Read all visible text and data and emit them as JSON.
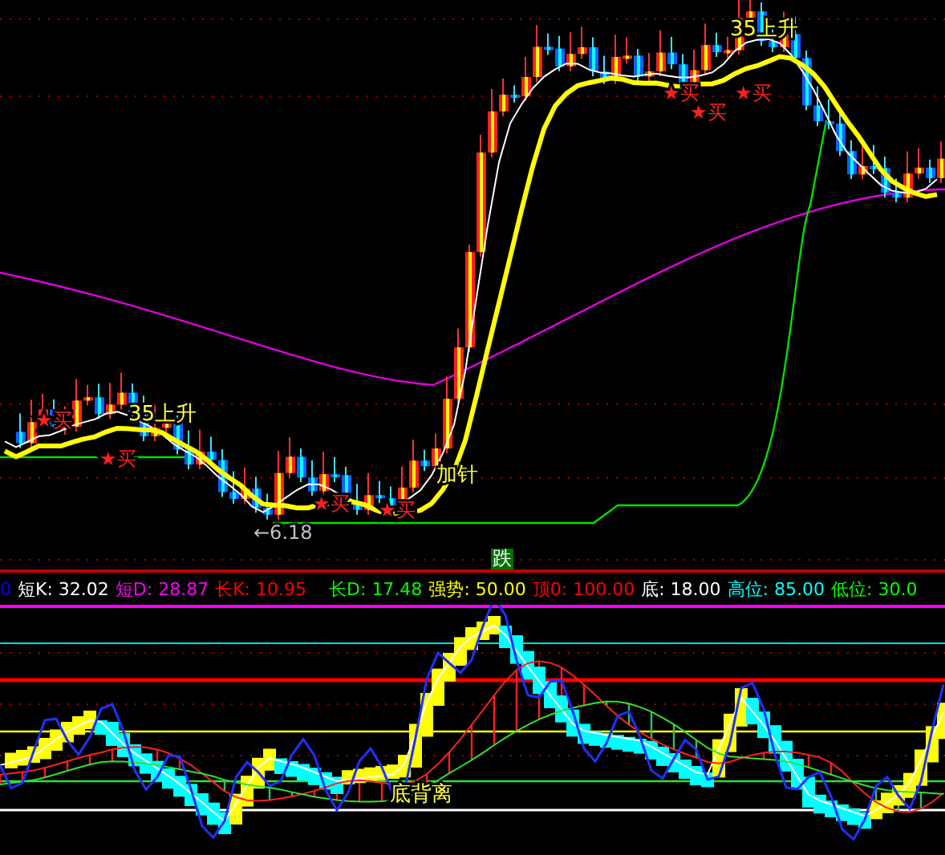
{
  "price_chart": {
    "annotations": [
      {
        "kind": "trend",
        "text": "35上升"
      },
      {
        "kind": "trend",
        "text": "35上升"
      },
      {
        "kind": "trend",
        "text": "加针"
      },
      {
        "kind": "buy",
        "text": "★买"
      },
      {
        "kind": "buy",
        "text": "★买"
      },
      {
        "kind": "buy",
        "text": "★买"
      },
      {
        "kind": "buy",
        "text": "★买"
      },
      {
        "kind": "buy",
        "text": "★买"
      },
      {
        "kind": "buy",
        "text": "★买"
      },
      {
        "kind": "buy",
        "text": "★买"
      },
      {
        "kind": "low",
        "text": "←6.18"
      }
    ]
  },
  "signal_badge": "跌",
  "indicators": [
    {
      "text": "0",
      "color": "#0000ff"
    },
    {
      "text": "短K: 32.02",
      "color": "#ffffff"
    },
    {
      "text": "短D: 28.87",
      "color": "#ff00ff"
    },
    {
      "text": "长K: 10.95",
      "color": "#ff0000"
    },
    {
      "text": "长D: 17.48",
      "color": "#00ff00"
    },
    {
      "text": "强势: 50.00",
      "color": "#ffff00"
    },
    {
      "text": "顶0: 100.00",
      "color": "#ff0000"
    },
    {
      "text": "底: 18.00",
      "color": "#ffffff"
    },
    {
      "text": "高位: 85.00",
      "color": "#00ffff"
    },
    {
      "text": "低位: 30.0",
      "color": "#00ff00"
    }
  ],
  "oscillator": {
    "annotations": [
      {
        "kind": "divergence",
        "text": "底背离"
      }
    ]
  }
}
